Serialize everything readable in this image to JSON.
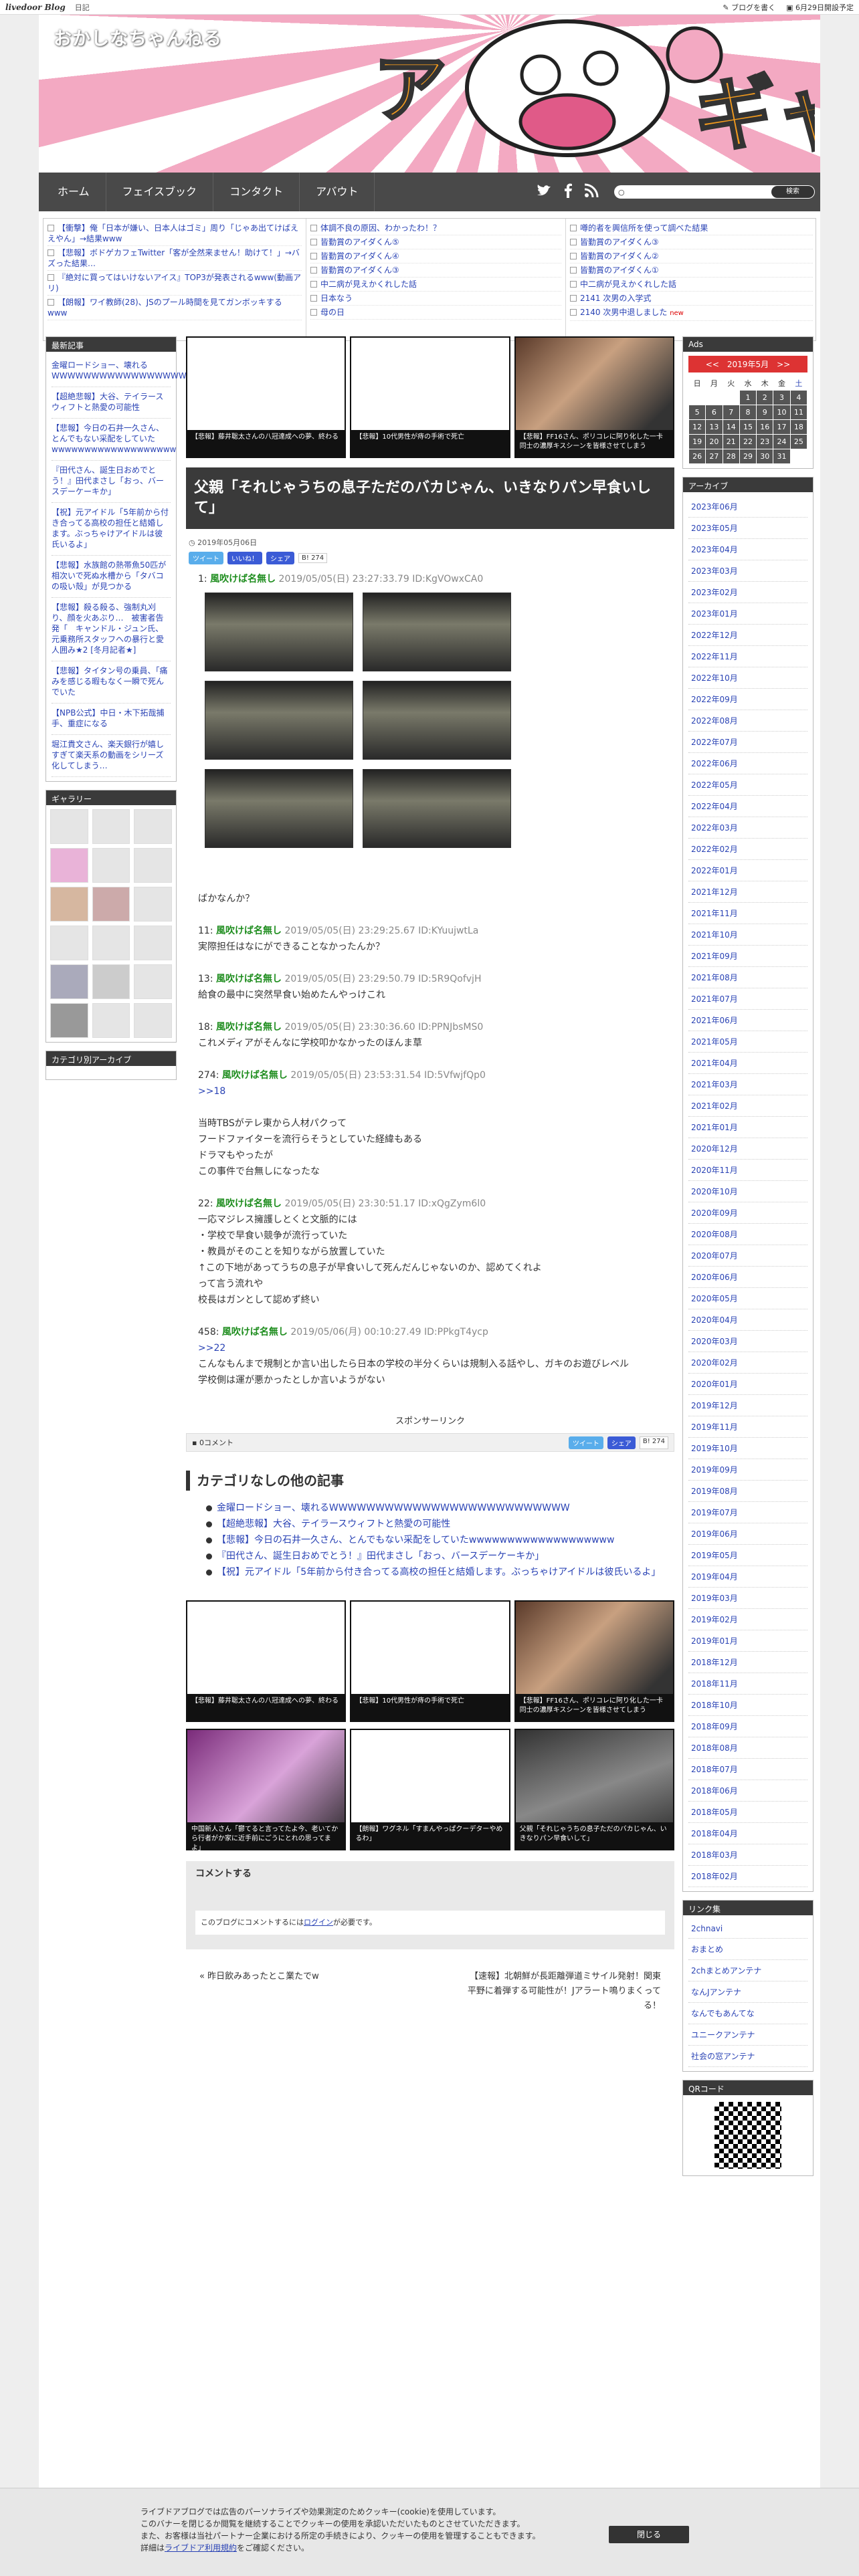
{
  "topbar": {
    "logo": "livedoor Blog",
    "diary": "日記",
    "write": "ブログを書く",
    "date": "6月29日開設予定"
  },
  "header": {
    "title": "おかしなちゃんねる"
  },
  "nav": {
    "items": [
      "ホーム",
      "フェイスブック",
      "コンタクト",
      "アバウト"
    ],
    "search_button": "検索"
  },
  "ticker": {
    "col1": [
      "【衝撃】俺「日本が嫌い、日本人はゴミ」周り「じゃあ出てけばええやん」→結果www",
      "【悲報】ボドゲカフェTwitter「客が全然来ません！助けて！」→バズった結果…",
      "『絶対に買ってはいけないアイス』TOP3が発表されるwww(動画アリ)",
      "【朗報】ワイ教師(28)、JSのプール時間を見てガンボッキするwww"
    ],
    "col2": [
      "体調不良の原因、わかったわ！？",
      "皆勤賞のアイダくん⑤",
      "皆勤賞のアイダくん④",
      "皆勤賞のアイダくん③",
      "中二病が見えかくれした話",
      "日本なう",
      "母の日"
    ],
    "col3": [
      "噂的者を興信所を使って調べた結果",
      "皆勤賞のアイダくん③",
      "皆勤賞のアイダくん②",
      "皆勤賞のアイダくん①",
      "中二病が見えかくれした話",
      "2141 次男の入学式",
      "2140 次男中退しました"
    ],
    "new": "new"
  },
  "left": {
    "recent_title": "最新記事",
    "recent": [
      "金曜ロードショー、壊れるWWWWWWWWWWWWWWWWWWWWWWWWWW",
      "【超絶悲報】大谷、テイラースウィフトと熱愛の可能性",
      "【悲報】今日の石井一久さん、とんでもない采配をしていたwwwwwwwwwwwwwwwwwww",
      "『田代さん、誕生日おめでとう！』田代まさし「おっ、バースデーケーキか」",
      "【祝】元アイドル「5年前から付き合ってる高校の担任と結婚します。ぶっちゃけアイドルは彼氏いるよ」",
      "【悲報】水族館の熱帯魚50匹が相次いで死ぬ水槽から「タバコの吸い殻」が見つかる",
      "【悲報】殺る殺る、強制丸刈り、顔を火あぶり…　被害者告発「　キャンドル・ジュン氏、元乗務所スタッフへの暴行と愛人囲み★2 [冬月記者★]",
      "【悲報】タイタン号の乗員、「痛みを感じる暇もなく一瞬で死んでいた",
      "【NPB公式】中日・木下拓哉捕手、重症になる",
      "堀江貴文さん、楽天銀行が嬉しすぎて楽天系の動画をシリーズ化してしまう…"
    ],
    "gallery_title": "ギャラリー",
    "cat_title": "カテゴリ別アーカイブ"
  },
  "thumbs_top": [
    "【悲報】藤井聡太さんの八冠達成への夢、終わる",
    "【悲報】10代男性が痔の手術で死亡",
    "【悲報】FF16さん、ポリコレに阿り化した一卡同士の濃厚キスシーンを皆様させてしまう"
  ],
  "article": {
    "title": "父親「それじゃうちの息子ただのバカじゃん、いきなりパン早食いして」",
    "date": "2019年05月06日",
    "tweet": "ツイート",
    "like": "いいね！",
    "share": "シェア",
    "count": "274",
    "first": {
      "num": "1:",
      "name": "風吹けば名無し",
      "meta": "2019/05/05(日) 23:27:33.79 ID:KgVOwxCA0"
    },
    "line1": "ばかなんか？",
    "responses": [
      {
        "num": "11:",
        "name": "風吹けば名無し",
        "meta": "2019/05/05(日) 23:29:25.67 ID:KYuujwtLa",
        "text": [
          "実際担任はなにができることなかったんか？"
        ]
      },
      {
        "num": "13:",
        "name": "風吹けば名無し",
        "meta": "2019/05/05(日) 23:29:50.79 ID:5R9QofvjH",
        "text": [
          "給食の最中に突然早食い始めたんやっけこれ"
        ]
      },
      {
        "num": "18:",
        "name": "風吹けば名無し",
        "meta": "2019/05/05(日) 23:30:36.60 ID:PPNJbsMS0",
        "text": [
          "これメディアがそんなに学校叩かなかったのほんま草"
        ]
      },
      {
        "num": "274:",
        "name": "風吹けば名無し",
        "meta": "2019/05/05(日) 23:53:31.54 ID:5VfwjfQp0",
        "text": [
          ">>18",
          "",
          "当時TBSがテレ東から人材パクって",
          "フードファイターを流行らそうとしていた経緯もある",
          "ドラマもやったが",
          "この事件で台無しになったな"
        ]
      },
      {
        "num": "22:",
        "name": "風吹けば名無し",
        "meta": "2019/05/05(日) 23:30:51.17 ID:xQgZym6l0",
        "text": [
          "一応マジレス擁護しとくと文脈的には",
          "・学校で早食い競争が流行っていた",
          "・教員がそのことを知りながら放置していた",
          "↑この下地があってうちの息子が早食いして死んだんじゃないのか、認めてくれよ",
          "って言う流れや",
          "校長はガンとして認めず終い"
        ]
      },
      {
        "num": "458:",
        "name": "風吹けば名無し",
        "meta": "2019/05/06(月) 00:10:27.49 ID:PPkgT4ycp",
        "text": [
          ">>22",
          "こんなもんまで規制とか言い出したら日本の学校の半分くらいは規制入る話やし、ガキのお遊びレベル",
          "学校側は運が悪かったとしか言いようがない"
        ]
      }
    ],
    "sponsor": "スポンサーリンク",
    "comments_count": "0コメント"
  },
  "related": {
    "title": "カテゴリなしの他の記事",
    "items": [
      "金曜ロードショー、壊れるWWWWWWWWWWWWWWWWWWWWWWWWWW",
      "【超絶悲報】大谷、テイラースウィフトと熱愛の可能性",
      "【悲報】今日の石井一久さん、とんでもない采配をしていたwwwwwwwwwwwwwwwwwww",
      "『田代さん、誕生日おめでとう！』田代まさし「おっ、バースデーケーキか」",
      "【祝】元アイドル「5年前から付き合ってる高校の担任と結婚します。ぶっちゃけアイドルは彼氏いるよ」"
    ]
  },
  "thumbs_bottom": [
    "【悲報】藤井聡太さんの八冠達成への夢、終わる",
    "【悲報】10代男性が痔の手術で死亡",
    "【悲報】FF16さん、ポリコレに阿り化した一卡同士の濃厚キスシーンを皆様させてしまう",
    "中国新人さん「鬱てると言ってたよ今、老いてから行者がか家に近手前にごうにとれの思ってまよ」",
    "【朗報】ワグネル「すまんやっぱクーデターやめるわ」",
    "父親「それじゃうちの息子ただのバカじゃん、いきなりパン早食いして」"
  ],
  "comment_section": {
    "title": "コメントする",
    "notice_pre": "このブログにコメントするには",
    "login": "ログイン",
    "notice_post": "が必要です。"
  },
  "pager": {
    "prev": "« 昨日飲みあったとこ業たでw",
    "next": "【速報】北朝鮮が長距離弾道ミサイル発射！関東平野に着弾する可能性が！Jアラート鳴りまくってる！"
  },
  "right": {
    "ads_title": "Ads",
    "cal_head": "<<　2019年5月　>>",
    "dow": [
      "日",
      "月",
      "火",
      "水",
      "木",
      "金",
      "土"
    ],
    "weeks": [
      [
        "",
        "",
        "",
        "1",
        "2",
        "3",
        "4"
      ],
      [
        "5",
        "6",
        "7",
        "8",
        "9",
        "10",
        "11"
      ],
      [
        "12",
        "13",
        "14",
        "15",
        "16",
        "17",
        "18"
      ],
      [
        "19",
        "20",
        "21",
        "22",
        "23",
        "24",
        "25"
      ],
      [
        "26",
        "27",
        "28",
        "29",
        "30",
        "31",
        ""
      ]
    ],
    "archive_title": "アーカイブ",
    "archive": [
      "2023年06月",
      "2023年05月",
      "2023年04月",
      "2023年03月",
      "2023年02月",
      "2023年01月",
      "2022年12月",
      "2022年11月",
      "2022年10月",
      "2022年09月",
      "2022年08月",
      "2022年07月",
      "2022年06月",
      "2022年05月",
      "2022年04月",
      "2022年03月",
      "2022年02月",
      "2022年01月",
      "2021年12月",
      "2021年11月",
      "2021年10月",
      "2021年09月",
      "2021年08月",
      "2021年07月",
      "2021年06月",
      "2021年05月",
      "2021年04月",
      "2021年03月",
      "2021年02月",
      "2021年01月",
      "2020年12月",
      "2020年11月",
      "2020年10月",
      "2020年09月",
      "2020年08月",
      "2020年07月",
      "2020年06月",
      "2020年05月",
      "2020年04月",
      "2020年03月",
      "2020年02月",
      "2020年01月",
      "2019年12月",
      "2019年11月",
      "2019年10月",
      "2019年09月",
      "2019年08月",
      "2019年07月",
      "2019年06月",
      "2019年05月",
      "2019年04月",
      "2019年03月",
      "2019年02月",
      "2019年01月",
      "2018年12月",
      "2018年11月",
      "2018年10月",
      "2018年09月",
      "2018年08月",
      "2018年07月",
      "2018年06月",
      "2018年05月",
      "2018年04月",
      "2018年03月",
      "2018年02月"
    ],
    "links_title": "リンク集",
    "links": [
      "2chnavi",
      "おまとめ",
      "2chまとめアンテナ",
      "なんJアンテナ",
      "なんでもあんてな",
      "ユニークアンテナ",
      "社会の窓アンテナ"
    ],
    "qr_title": "QRコード"
  },
  "cookie": {
    "lines": [
      "ライブドアブログでは広告のパーソナライズや効果測定のためクッキー(cookie)を使用しています。",
      "このバナーを閉じるか閲覧を継続することでクッキーの使用を承認いただいたものとさせていただきます。",
      "また、お客様は当社パートナー企業における所定の手続きにより、クッキーの使用を管理することもできます。"
    ],
    "more_pre": "詳細は",
    "more_link": "ライブドア利用規約",
    "more_post": "をご確認ください。",
    "close": "閉じる"
  }
}
